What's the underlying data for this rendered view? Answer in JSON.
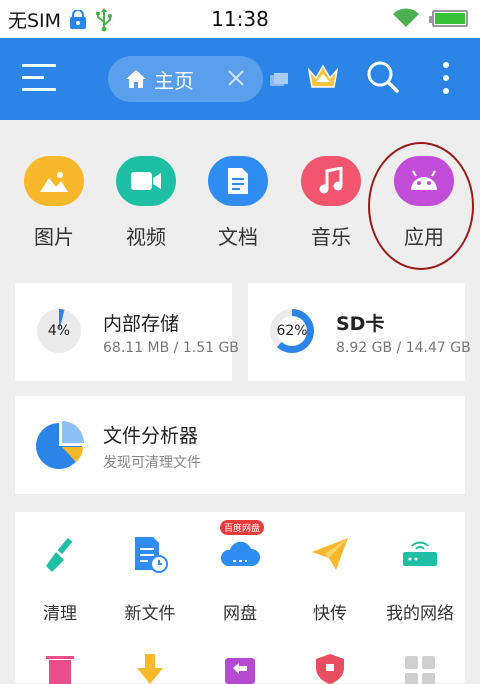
{
  "status_bar": {
    "carrier": "无SIM",
    "time": "11:38"
  },
  "toolbar": {
    "tab_label": "主页",
    "accent_color": "#2c84e7"
  },
  "categories": [
    {
      "label": "图片",
      "icon": "image-icon",
      "color": "#f7b92b"
    },
    {
      "label": "视频",
      "icon": "video-icon",
      "color": "#1fbfa6"
    },
    {
      "label": "文档",
      "icon": "document-icon",
      "color": "#2f8cf0"
    },
    {
      "label": "音乐",
      "icon": "music-icon",
      "color": "#f2566f"
    },
    {
      "label": "应用",
      "icon": "android-icon",
      "color": "#c24dd8"
    }
  ],
  "storage": [
    {
      "title": "内部存储",
      "percent": "4%",
      "used": "68.11 MB / 1.51 GB",
      "fraction": 0.04
    },
    {
      "title": "SD卡",
      "percent": "62%",
      "used": "8.92 GB / 14.47 GB",
      "fraction": 0.62
    }
  ],
  "analyzer": {
    "title": "文件分析器",
    "subtitle": "发现可清理文件"
  },
  "tools": [
    {
      "label": "清理",
      "icon": "broom-icon"
    },
    {
      "label": "新文件",
      "icon": "new-file-icon"
    },
    {
      "label": "网盘",
      "icon": "cloud-icon",
      "badge": "百度网盘"
    },
    {
      "label": "快传",
      "icon": "paper-plane-icon"
    },
    {
      "label": "我的网络",
      "icon": "router-icon"
    }
  ]
}
